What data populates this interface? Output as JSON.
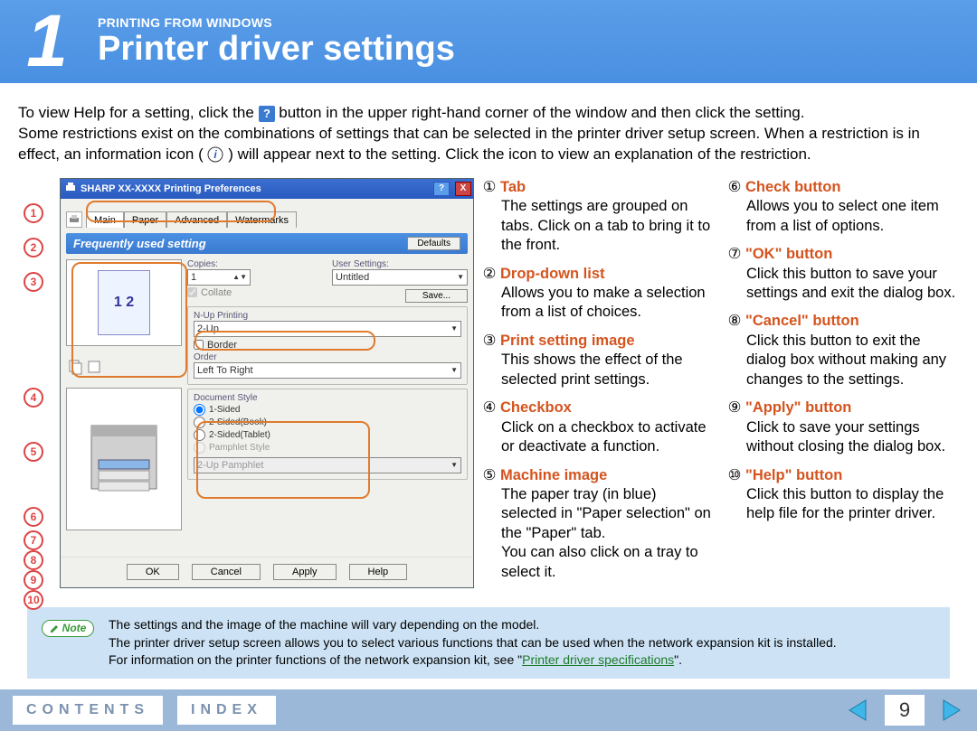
{
  "header": {
    "chapter_number": "1",
    "breadcrumb": "PRINTING FROM WINDOWS",
    "title": "Printer driver settings"
  },
  "intro": {
    "line1a": "To view Help for a setting, click the ",
    "line1b": " button in the upper right-hand corner of the window and then click the setting.",
    "line2a": "Some restrictions exist on the combinations of settings that can be selected in the printer driver setup screen. When a restriction is in effect, an information icon ( ",
    "line2b": " ) will appear next to the setting. Click the icon to view an explanation of the restriction."
  },
  "dialog": {
    "title": "SHARP XX-XXXX Printing Preferences",
    "close_x": "X",
    "help_q": "?",
    "tabs": [
      "Main",
      "Paper",
      "Advanced",
      "Watermarks"
    ],
    "freq_title": "Frequently used setting",
    "defaults_btn": "Defaults",
    "copies_lbl": "Copies:",
    "copies_val": "1",
    "usersettings_lbl": "User Settings:",
    "usersettings_val": "Untitled",
    "save_btn": "Save...",
    "collate_lbl": "Collate",
    "nup_lbl": "N-Up Printing",
    "nup_val": "2-Up",
    "border_lbl": "Border",
    "order_lbl": "Order",
    "order_val": "Left To Right",
    "docstyle_lbl": "Document Style",
    "docstyle_opts": [
      "1-Sided",
      "2-Sided(Book)",
      "2-Sided(Tablet)",
      "Pamphlet Style"
    ],
    "docstyle_disabled": "2-Up Pamphlet",
    "preview_digits": "1  2",
    "buttons": {
      "ok": "OK",
      "cancel": "Cancel",
      "apply": "Apply",
      "help": "Help"
    }
  },
  "callouts": {
    "nums": [
      "1",
      "2",
      "3",
      "4",
      "5",
      "6",
      "7",
      "8",
      "9",
      "10"
    ]
  },
  "descriptions_left": [
    {
      "n": "①",
      "title": "Tab",
      "body": "The settings are grouped on tabs. Click on a tab to bring it to the front."
    },
    {
      "n": "②",
      "title": "Drop-down list",
      "body": "Allows you to make a selection from a list of choices."
    },
    {
      "n": "③",
      "title": "Print setting image",
      "body": "This shows the effect of the selected print settings."
    },
    {
      "n": "④",
      "title": "Checkbox",
      "body": "Click on a checkbox to activate or deactivate a function."
    },
    {
      "n": "⑤",
      "title": "Machine image",
      "body": "The paper tray (in blue) selected in \"Paper selection\" on the \"Paper\" tab.\nYou can also click on a tray to select it."
    }
  ],
  "descriptions_right": [
    {
      "n": "⑥",
      "title": "Check button",
      "body": "Allows you to select one item from a list of options."
    },
    {
      "n": "⑦",
      "title": "\"OK\" button",
      "body": "Click this button to save your settings and exit the dialog box."
    },
    {
      "n": "⑧",
      "title": "\"Cancel\" button",
      "body": "Click this button to exit the dialog box without making any changes to the settings."
    },
    {
      "n": "⑨",
      "title": "\"Apply\" button",
      "body": "Click to save your settings without closing the dialog box."
    },
    {
      "n": "⑩",
      "title": "\"Help\" button",
      "body": "Click this button to display the help file for the printer driver."
    }
  ],
  "note": {
    "tag": "Note",
    "lines": [
      "The settings and the image of the machine will vary depending on the model.",
      "The printer driver setup screen allows you to select various functions that can be used when the network expansion kit is installed.",
      "For information on the printer functions of the network expansion kit, see \""
    ],
    "link": "Printer driver specifications",
    "trail": "\"."
  },
  "footer": {
    "contents": "CONTENTS",
    "index": "INDEX",
    "page": "9"
  }
}
